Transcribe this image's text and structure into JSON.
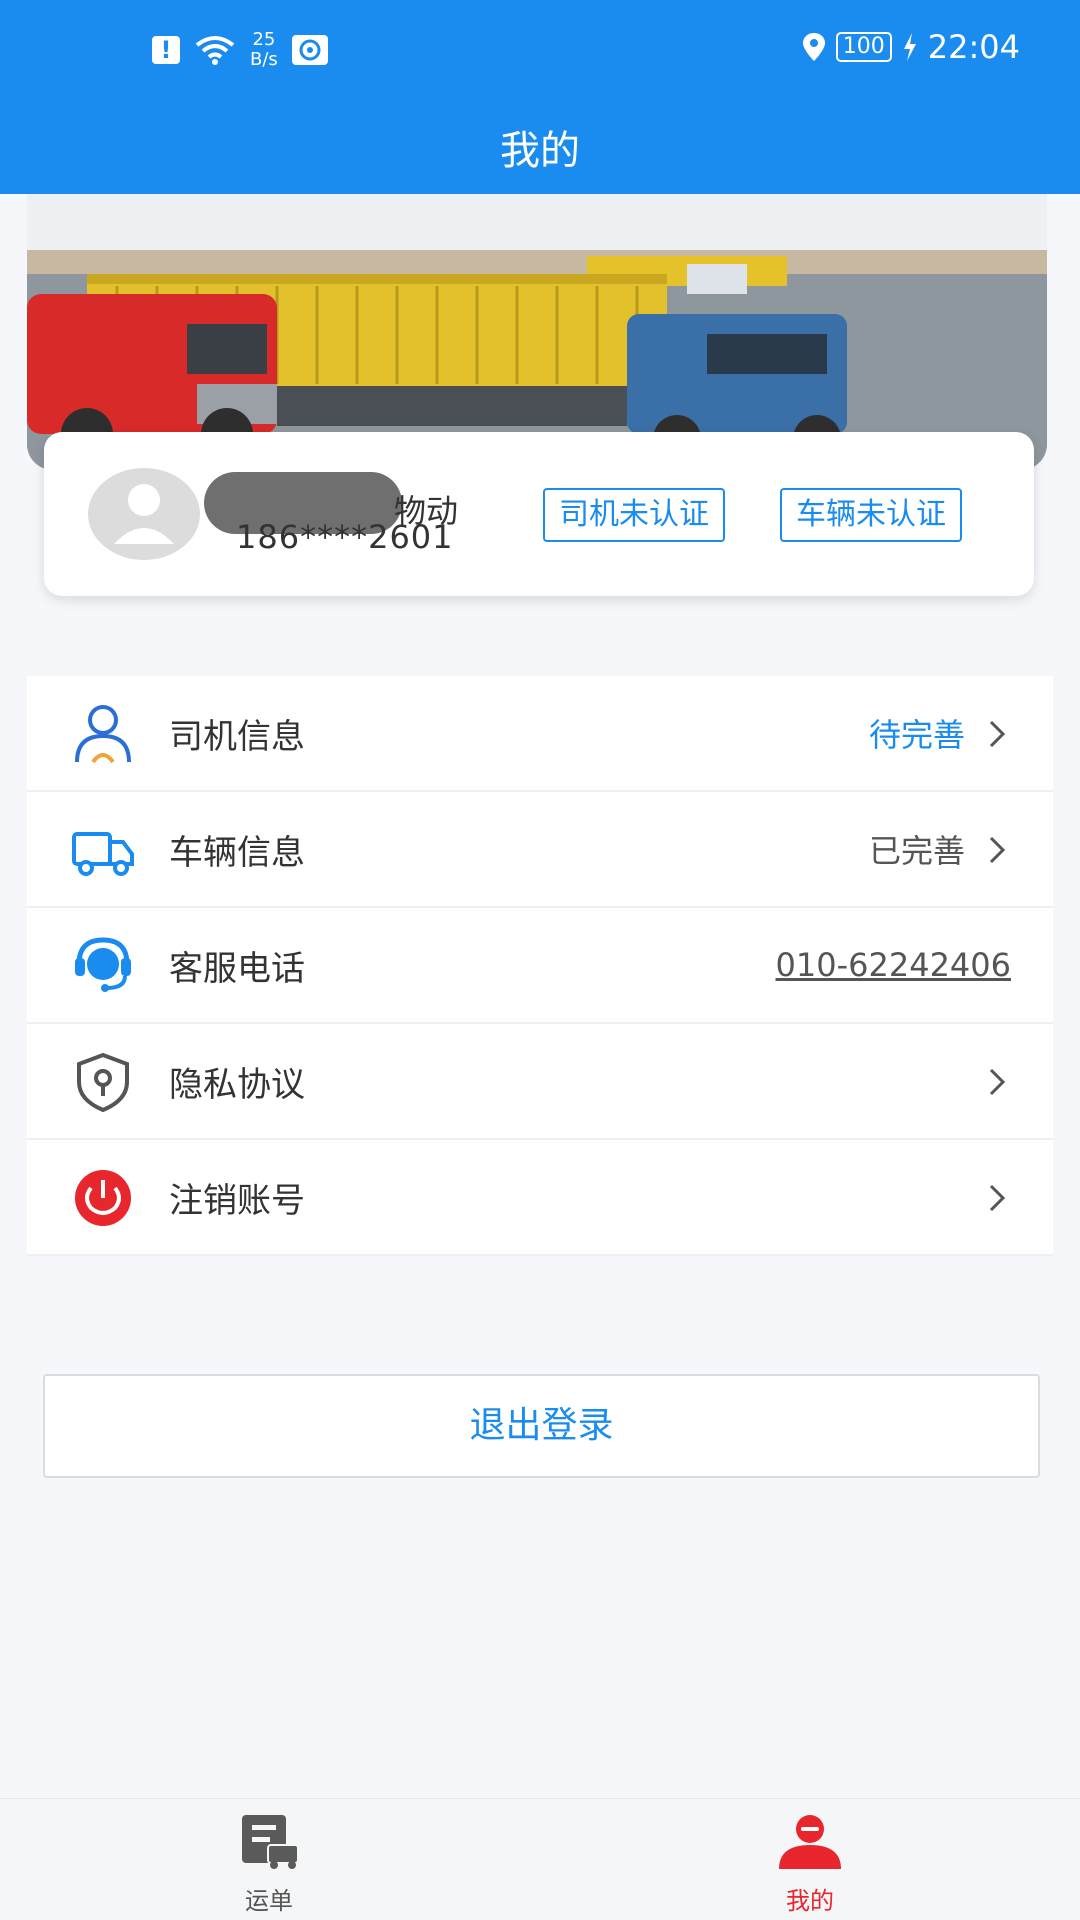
{
  "status_bar": {
    "net_speed_value": "25",
    "net_speed_unit": "B/s",
    "battery": "100",
    "time": "22:04"
  },
  "header": {
    "title": "我的"
  },
  "profile": {
    "name_visible": "物动",
    "phone": "186****2601",
    "badges": [
      "司机未认证",
      "车辆未认证"
    ]
  },
  "menu": {
    "items": [
      {
        "label": "司机信息",
        "value": "待完善",
        "icon": "driver-icon"
      },
      {
        "label": "车辆信息",
        "value": "已完善",
        "icon": "truck-icon"
      },
      {
        "label": "客服电话",
        "value": "010-62242406",
        "icon": "headset-icon"
      },
      {
        "label": "隐私协议",
        "value": "",
        "icon": "shield-lock-icon"
      },
      {
        "label": "注销账号",
        "value": "",
        "icon": "power-icon"
      }
    ]
  },
  "logout": {
    "label": "退出登录"
  },
  "tabbar": {
    "tabs": [
      {
        "label": "运单",
        "icon": "waybill-icon",
        "active": false
      },
      {
        "label": "我的",
        "icon": "profile-icon",
        "active": true
      }
    ],
    "active_color": "#e8262d",
    "inactive_color": "#555555"
  },
  "colors": {
    "primary": "#1a8cf0",
    "danger": "#e8262d"
  }
}
